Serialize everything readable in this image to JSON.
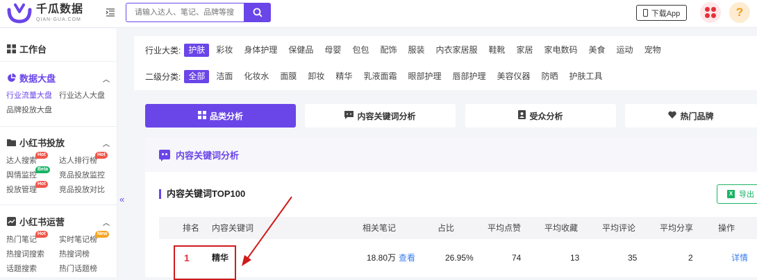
{
  "header": {
    "logo_cn": "千瓜数据",
    "logo_en": "QIAN-GUA.COM",
    "search_placeholder": "请输入达人、笔记、品牌等搜",
    "download_label": "下载App",
    "help_label": "?"
  },
  "sidebar": {
    "workbench": "工作台",
    "sections": [
      {
        "title": "数据大盘",
        "items": [
          "行业流量大盘",
          "行业达人大盘",
          "品牌投放大盘"
        ]
      },
      {
        "title": "小红书投放",
        "items": [
          "达人搜索",
          "达人排行榜",
          "舆情监控",
          "竞品投放监控",
          "投放管理",
          "竞品投放对比"
        ]
      },
      {
        "title": "小红书运营",
        "items": [
          "热门笔记",
          "实时笔记榜",
          "热搜词搜索",
          "热搜词榜",
          "话题搜索",
          "热门话题榜"
        ]
      }
    ],
    "badges": {
      "hot": "Hot",
      "beta": "Beta",
      "new": "New"
    },
    "collapse": "«"
  },
  "filters": {
    "industry_label": "行业大类:",
    "industry": [
      "护肤",
      "彩妆",
      "身体护理",
      "保健品",
      "母婴",
      "包包",
      "配饰",
      "服装",
      "内衣家居服",
      "鞋靴",
      "家居",
      "家电数码",
      "美食",
      "运动",
      "宠物"
    ],
    "sub_label": "二级分类:",
    "sub": [
      "全部",
      "洁面",
      "化妆水",
      "面膜",
      "卸妆",
      "精华",
      "乳液面霜",
      "眼部护理",
      "唇部护理",
      "美容仪器",
      "防晒",
      "护肤工具"
    ]
  },
  "tabs": [
    "品类分析",
    "内容关键词分析",
    "受众分析",
    "热门品牌"
  ],
  "card": {
    "title": "内容关键词分析",
    "subtitle": "内容关键词TOP100",
    "export_label": "导出",
    "export_icon_letter": "X"
  },
  "table": {
    "headers": [
      "排名",
      "内容关键词",
      "相关笔记",
      "占比",
      "平均点赞",
      "平均收藏",
      "平均评论",
      "平均分享",
      "操作"
    ],
    "rows": [
      {
        "rank": "1",
        "keyword": "精华",
        "notes": "18.80万",
        "view": "查看",
        "ratio": "26.95%",
        "likes": "74",
        "favs": "13",
        "comments": "35",
        "shares": "2",
        "action": "详情"
      }
    ]
  },
  "colors": {
    "accent": "#6a45e8",
    "highlight": "#d11a1a",
    "export": "#19b364",
    "link": "#3b7ded"
  }
}
